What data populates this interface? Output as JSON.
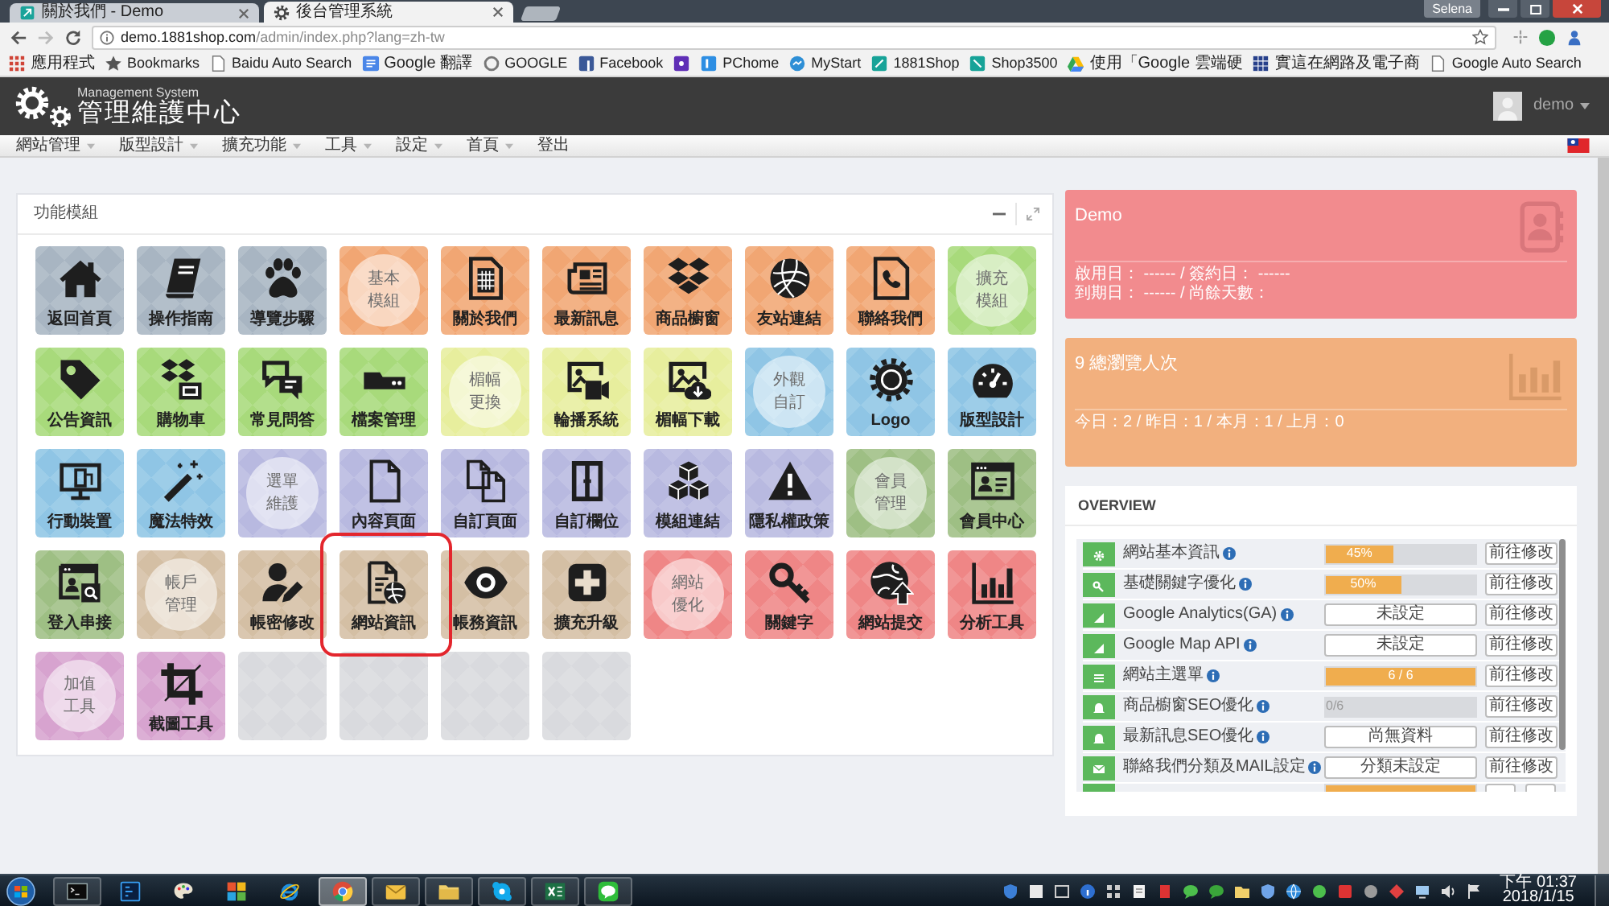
{
  "browser": {
    "tabs": [
      {
        "label": "關於我們 - Demo",
        "selected": false
      },
      {
        "label": "後台管理系統",
        "selected": true
      }
    ],
    "profile": "Selena",
    "url": {
      "host": "demo.1881shop.com",
      "path": "/admin/index.php?lang=zh-tw"
    },
    "bookmarks": [
      {
        "kind": "link",
        "label": "應用程式"
      },
      {
        "kind": "link",
        "label": "Bookmarks"
      },
      {
        "kind": "link",
        "label": "Baidu Auto Search"
      },
      {
        "kind": "link",
        "label": "Google 翻譯"
      },
      {
        "kind": "link",
        "label": "GOOGLE"
      },
      {
        "kind": "link",
        "label": "Facebook"
      },
      {
        "kind": "icon"
      },
      {
        "kind": "link",
        "label": "PChome"
      },
      {
        "kind": "link",
        "label": "MyStart"
      },
      {
        "kind": "link",
        "label": "1881Shop"
      },
      {
        "kind": "link",
        "label": "Shop3500"
      },
      {
        "kind": "link",
        "label": "使用「Google 雲端硬"
      },
      {
        "kind": "link",
        "label": "實這在網路及電子商"
      },
      {
        "kind": "link",
        "label": "Google Auto Search"
      }
    ]
  },
  "header": {
    "subtitle": "Management System",
    "title": "管理維護中心",
    "user": "demo"
  },
  "nav": {
    "items": [
      {
        "label": "網站管理",
        "dropdown": true
      },
      {
        "label": "版型設計",
        "dropdown": true
      },
      {
        "label": "擴充功能",
        "dropdown": true
      },
      {
        "label": "工具",
        "dropdown": true
      },
      {
        "label": "設定",
        "dropdown": true
      },
      {
        "label": "首頁",
        "dropdown": true
      },
      {
        "label": "登出",
        "dropdown": false
      }
    ]
  },
  "modules": {
    "title": "功能模組",
    "tiles": [
      {
        "label": "返回首頁",
        "kind": "icon",
        "color": "#a8b5c2",
        "highlighted": false
      },
      {
        "label": "操作指南",
        "kind": "icon",
        "color": "#a8b5c2",
        "highlighted": false
      },
      {
        "label": "導覽步驟",
        "kind": "icon",
        "color": "#a8b5c2",
        "highlighted": false
      },
      {
        "label": "基本模組",
        "kind": "circle",
        "color": "#f1a673",
        "highlighted": false
      },
      {
        "label": "關於我們",
        "kind": "icon",
        "color": "#f1a673",
        "highlighted": false
      },
      {
        "label": "最新訊息",
        "kind": "icon",
        "color": "#f1a673",
        "highlighted": false
      },
      {
        "label": "商品櫥窗",
        "kind": "icon",
        "color": "#f1a673",
        "highlighted": false
      },
      {
        "label": "友站連結",
        "kind": "icon",
        "color": "#f1a673",
        "highlighted": false
      },
      {
        "label": "聯絡我們",
        "kind": "icon",
        "color": "#f1a673",
        "highlighted": false
      },
      {
        "label": "擴充模組",
        "kind": "circle",
        "color": "#a8da7b",
        "highlighted": false
      },
      {
        "label": "公告資訊",
        "kind": "icon",
        "color": "#a8da7b",
        "highlighted": false
      },
      {
        "label": "購物車",
        "kind": "icon",
        "color": "#a8da7b",
        "highlighted": false
      },
      {
        "label": "常見問答",
        "kind": "icon",
        "color": "#a8da7b",
        "highlighted": false
      },
      {
        "label": "檔案管理",
        "kind": "icon",
        "color": "#a8da7b",
        "highlighted": false
      },
      {
        "label": "楣幅更換",
        "kind": "circle",
        "color": "#e7ee9d",
        "highlighted": false
      },
      {
        "label": "輪播系統",
        "kind": "icon",
        "color": "#e7ee9d",
        "highlighted": false
      },
      {
        "label": "楣幅下載",
        "kind": "icon",
        "color": "#e7ee9d",
        "highlighted": false
      },
      {
        "label": "外觀自訂",
        "kind": "circle",
        "color": "#8fc5e5",
        "highlighted": false
      },
      {
        "label": "Logo",
        "kind": "icon",
        "color": "#8fc5e5",
        "highlighted": false
      },
      {
        "label": "版型設計",
        "kind": "icon",
        "color": "#8fc5e5",
        "highlighted": false
      },
      {
        "label": "行動裝置",
        "kind": "icon",
        "color": "#8fc5e5",
        "highlighted": false
      },
      {
        "label": "魔法特效",
        "kind": "icon",
        "color": "#8fc5e5",
        "highlighted": false
      },
      {
        "label": "選單維護",
        "kind": "circle",
        "color": "#b8b9e0",
        "highlighted": false
      },
      {
        "label": "內容頁面",
        "kind": "icon",
        "color": "#b8b9e0",
        "highlighted": false
      },
      {
        "label": "自訂頁面",
        "kind": "icon",
        "color": "#b8b9e0",
        "highlighted": false
      },
      {
        "label": "自訂欄位",
        "kind": "icon",
        "color": "#b8b9e0",
        "highlighted": false
      },
      {
        "label": "模組連結",
        "kind": "icon",
        "color": "#b8b9e0",
        "highlighted": false
      },
      {
        "label": "隱私權政策",
        "kind": "icon",
        "color": "#b8b9e0",
        "highlighted": false
      },
      {
        "label": "會員管理",
        "kind": "circle",
        "color": "#9ebf84",
        "highlighted": false
      },
      {
        "label": "會員中心",
        "kind": "icon",
        "color": "#9ebf84",
        "highlighted": false
      },
      {
        "label": "登入串接",
        "kind": "icon",
        "color": "#9ebf84",
        "highlighted": false
      },
      {
        "label": "帳戶管理",
        "kind": "circle",
        "color": "#d4bfa4",
        "highlighted": false
      },
      {
        "label": "帳密修改",
        "kind": "icon",
        "color": "#d4bfa4",
        "highlighted": false
      },
      {
        "label": "網站資訊",
        "kind": "icon",
        "color": "#d4bfa4",
        "highlighted": true
      },
      {
        "label": "帳務資訊",
        "kind": "icon",
        "color": "#d4bfa4",
        "highlighted": false
      },
      {
        "label": "擴充升級",
        "kind": "icon",
        "color": "#d4bfa4",
        "highlighted": false
      },
      {
        "label": "網站優化",
        "kind": "circle",
        "color": "#ef8686",
        "highlighted": false
      },
      {
        "label": "關鍵字",
        "kind": "icon",
        "color": "#ef8686",
        "highlighted": false
      },
      {
        "label": "網站提交",
        "kind": "icon",
        "color": "#ef8686",
        "highlighted": false
      },
      {
        "label": "分析工具",
        "kind": "icon",
        "color": "#ef8686",
        "highlighted": false
      },
      {
        "label": "加值工具",
        "kind": "circle",
        "color": "#d7a3cf",
        "highlighted": false
      },
      {
        "label": "截圖工具",
        "kind": "icon",
        "color": "#d7a3cf",
        "highlighted": false
      },
      {
        "kind": "empty",
        "color": "#d9dade",
        "highlighted": false
      },
      {
        "kind": "empty",
        "color": "#d9dade",
        "highlighted": false
      },
      {
        "kind": "empty",
        "color": "#d9dade",
        "highlighted": false
      },
      {
        "kind": "empty",
        "color": "#d9dade",
        "highlighted": false
      }
    ]
  },
  "account_card": {
    "title": "Demo",
    "lines": [
      "啟用日： ------ / 簽約日： ------",
      "到期日： ------ / 尚餘天數："
    ]
  },
  "visits_card": {
    "title": "9 總瀏覽人次",
    "lines": [
      "今日：2 / 昨日：1 / 本月：1 / 上月：0"
    ]
  },
  "overview": {
    "title": "OVERVIEW",
    "rows": [
      {
        "label": "網站基本資訊",
        "kind": "bar",
        "level": 0.45,
        "value": "45%",
        "action": "前往修改"
      },
      {
        "label": "基礎關鍵字優化",
        "kind": "bar",
        "level": 0.5,
        "value": "50%",
        "action": "前往修改"
      },
      {
        "label": "Google Analytics(GA)",
        "kind": "button",
        "value": "未設定",
        "action": "前往修改"
      },
      {
        "label": "Google Map API",
        "kind": "button",
        "value": "未設定",
        "action": "前往修改"
      },
      {
        "label": "網站主選單",
        "kind": "bar",
        "level": 1,
        "value": "6 / 6",
        "action": "前往修改"
      },
      {
        "label": "商品櫥窗SEO優化",
        "kind": "bar",
        "level": 0,
        "value": "0/6",
        "action": "前往修改"
      },
      {
        "label": "最新訊息SEO優化",
        "kind": "button",
        "value": "尚無資料",
        "action": "前往修改"
      },
      {
        "label": "聯絡我們分類及MAIL設定",
        "kind": "button",
        "value": "分類未設定",
        "action": "前往修改"
      }
    ],
    "cut_row": {
      "level": 1
    }
  },
  "taskbar": {
    "apps": [
      {
        "running": true,
        "selected": false
      },
      {
        "running": false,
        "selected": false
      },
      {
        "running": false,
        "selected": false
      },
      {
        "running": false,
        "selected": false
      },
      {
        "running": false,
        "selected": false
      },
      {
        "running": true,
        "selected": true
      },
      {
        "running": true,
        "selected": false
      },
      {
        "running": true,
        "selected": false
      },
      {
        "running": true,
        "selected": false
      },
      {
        "running": true,
        "selected": false
      },
      {
        "running": true,
        "selected": false
      }
    ],
    "time": "下午 01:37",
    "date": "2018/1/15"
  }
}
